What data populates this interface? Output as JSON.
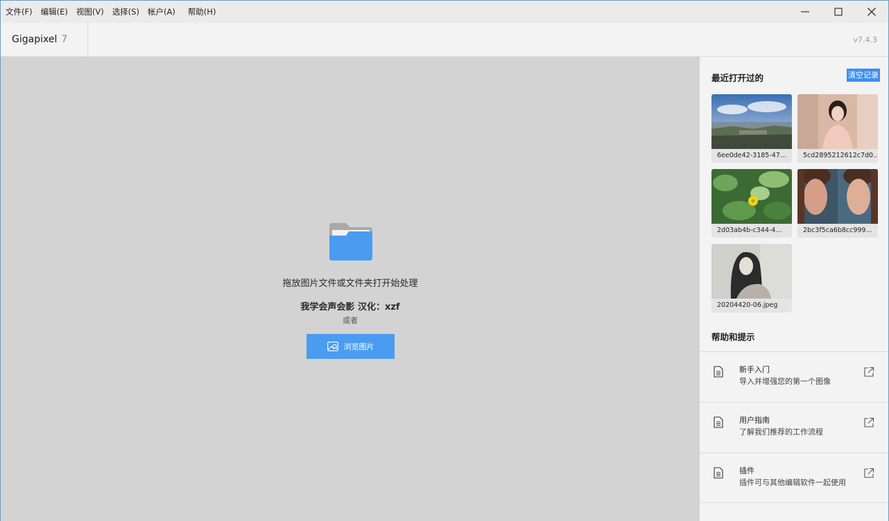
{
  "menu": [
    "文件(F)",
    "编辑(E)",
    "视图(V)",
    "选择(S)",
    "帐户(A)",
    "帮助(H)"
  ],
  "window_controls": {
    "minimize": "minimize-icon",
    "maximize": "maximize-icon",
    "close": "close-icon"
  },
  "app": {
    "name": "Gigapixel",
    "major_version": "7",
    "version": "v7.4.3"
  },
  "main": {
    "drop_text": "拖放图片文件或文件夹打开始处理",
    "credit_text": "我学会声会影 汉化：xzf",
    "or_text": "或者",
    "browse_label": "浏览图片"
  },
  "recent": {
    "title": "最近打开过的",
    "clear_label": "清空记录",
    "items": [
      {
        "name": "6ee0de42-3185-47..."
      },
      {
        "name": "5cd2895212612c7d0..."
      },
      {
        "name": "2d03ab4b-c344-4..."
      },
      {
        "name": "2bc3f5ca6b8cc999..."
      },
      {
        "name": "20204420-06.jpeg"
      }
    ]
  },
  "help": {
    "title": "帮助和提示",
    "items": [
      {
        "title": "新手入门",
        "desc": "导入并增强您的第一个图像"
      },
      {
        "title": "用户指南",
        "desc": "了解我们推荐的工作流程"
      },
      {
        "title": "插件",
        "desc": "插件可与其他编辑软件一起使用"
      }
    ]
  },
  "colors": {
    "accent": "#4a9cf0",
    "folder": "#3d8ff0"
  }
}
